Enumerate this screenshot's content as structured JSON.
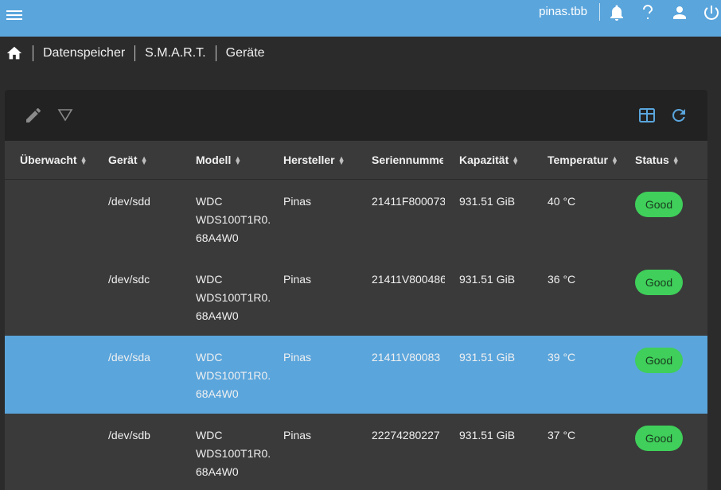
{
  "topbar": {
    "hostname": "pinas.tbb",
    "icons": [
      "menu-icon",
      "bell-icon",
      "help-icon",
      "user-icon",
      "power-icon"
    ]
  },
  "breadcrumb": {
    "items": [
      "Datenspeicher",
      "S.M.A.R.T.",
      "Geräte"
    ]
  },
  "toolbar": {
    "icons": [
      "edit-icon",
      "filter-icon",
      "table-columns-icon",
      "refresh-icon"
    ]
  },
  "table": {
    "columns": [
      "Überwacht",
      "Gerät",
      "Modell",
      "Hersteller",
      "Seriennumme",
      "Kapazität",
      "Temperatur",
      "Status"
    ],
    "rows": [
      {
        "monitored": "",
        "device": "/dev/sdd",
        "model": [
          "WDC",
          "WDS100T1R0.",
          "68A4W0"
        ],
        "vendor": "Pinas",
        "serial": "21411F800073",
        "capacity": "931.51 GiB",
        "temperature": "40 °C",
        "status": "Good",
        "selected": false
      },
      {
        "monitored": "",
        "device": "/dev/sdc",
        "model": [
          "WDC",
          "WDS100T1R0.",
          "68A4W0"
        ],
        "vendor": "Pinas",
        "serial": "21411V800486",
        "capacity": "931.51 GiB",
        "temperature": "36 °C",
        "status": "Good",
        "selected": false
      },
      {
        "monitored": "",
        "device": "/dev/sda",
        "model": [
          "WDC",
          "WDS100T1R0.",
          "68A4W0"
        ],
        "vendor": "Pinas",
        "serial": "21411V80083",
        "capacity": "931.51 GiB",
        "temperature": "39 °C",
        "status": "Good",
        "selected": true
      },
      {
        "monitored": "",
        "device": "/dev/sdb",
        "model": [
          "WDC",
          "WDS100T1R0.",
          "68A4W0"
        ],
        "vendor": "Pinas",
        "serial": "22274280227",
        "capacity": "931.51 GiB",
        "temperature": "37 °C",
        "status": "Good",
        "selected": false
      }
    ]
  },
  "colors": {
    "accent": "#5aa5dc",
    "status_good": "#3fcf5a",
    "background": "#2b2b2b",
    "panel": "#3a3a3a",
    "toolbar": "#222222"
  }
}
